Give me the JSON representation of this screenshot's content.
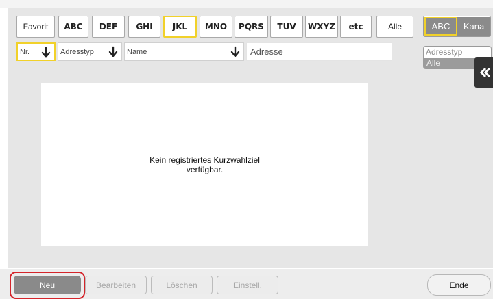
{
  "tabs": [
    {
      "label": "Favorit",
      "style": "normal",
      "selected": false
    },
    {
      "label": "ABC",
      "style": "bold",
      "selected": false
    },
    {
      "label": "DEF",
      "style": "bold",
      "selected": false
    },
    {
      "label": "GHI",
      "style": "bold",
      "selected": false
    },
    {
      "label": "JKL",
      "style": "bold",
      "selected": true
    },
    {
      "label": "MNO",
      "style": "bold",
      "selected": false
    },
    {
      "label": "PQRS",
      "style": "bold",
      "selected": false
    },
    {
      "label": "TUV",
      "style": "bold",
      "selected": false
    },
    {
      "label": "WXYZ",
      "style": "bold",
      "selected": false
    },
    {
      "label": "etc",
      "style": "bold",
      "selected": false
    },
    {
      "label": "Alle",
      "style": "normal",
      "selected": false
    }
  ],
  "mode_toggle": {
    "abc": "ABC",
    "kana": "Kana",
    "active": "ABC"
  },
  "columns": {
    "nr": "Nr.",
    "type": "Adresstyp",
    "name": "Name",
    "address": "Adresse"
  },
  "filter": {
    "label": "Adresstyp",
    "value": "Alle"
  },
  "list": {
    "empty_message": "Kein registriertes Kurzwahlziel\nverfügbar."
  },
  "bottom": {
    "new": "Neu",
    "edit": "Bearbeiten",
    "delete": "Löschen",
    "settings": "Einstell.",
    "end": "Ende"
  },
  "colors": {
    "highlight": "#f1d12a",
    "focus_ring": "#d4242a",
    "active_button": "#8a8a8a"
  },
  "icons": {
    "sort": "down-arrow-icon",
    "side_toggle": "double-chevron-left-icon"
  }
}
